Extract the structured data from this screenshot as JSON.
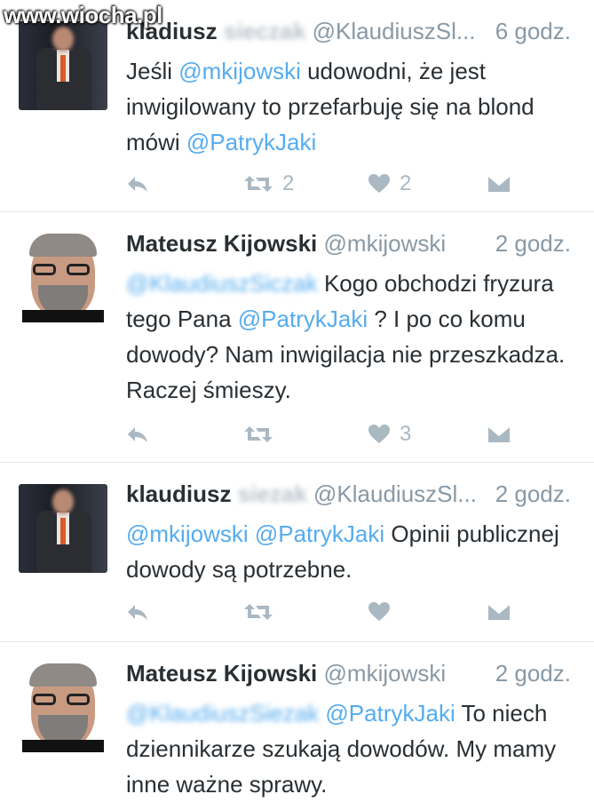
{
  "watermark": "www.wiocha.pl",
  "tweets": [
    {
      "name": "kladiusz",
      "name_hidden": "sieczak",
      "handle": "@KlaudiuszSl...",
      "time": "6 godz.",
      "text": [
        {
          "t": "Jeśli "
        },
        {
          "t": "@mkijowski",
          "cls": "mention"
        },
        {
          "t": " udowodni, że jest inwigilowany to przefarbuję się na blond mówi "
        },
        {
          "t": "@PatrykJaki",
          "cls": "mention"
        }
      ],
      "retweets": "2",
      "likes": "2"
    },
    {
      "name": "Mateusz Kijowski",
      "handle": "@mkijowski",
      "time": "2 godz.",
      "text": [
        {
          "t": "@KlaudiuszSiczak",
          "cls": "mention-blur"
        },
        {
          "t": " Kogo obchodzi fryzura tego Pana "
        },
        {
          "t": "@PatrykJaki",
          "cls": "mention"
        },
        {
          "t": " ? I po co komu dowody? Nam inwigilacja nie przeszkadza. Raczej śmieszy."
        }
      ],
      "retweets": "",
      "likes": "3"
    },
    {
      "name": "klaudiusz",
      "name_hidden": "siezak",
      "handle": "@KlaudiuszSl...",
      "time": "2 godz.",
      "text": [
        {
          "t": "@mkijowski",
          "cls": "mention"
        },
        {
          "t": " "
        },
        {
          "t": "@PatrykJaki",
          "cls": "mention"
        },
        {
          "t": " Opinii publicznej dowody są potrzebne."
        }
      ],
      "retweets": "",
      "likes": ""
    },
    {
      "name": "Mateusz Kijowski",
      "handle": "@mkijowski",
      "time": "2 godz.",
      "text": [
        {
          "t": "@KlaudiuszSiezak",
          "cls": "mention-blur"
        },
        {
          "t": " "
        },
        {
          "t": "@PatrykJaki",
          "cls": "mention"
        },
        {
          "t": " To niech dziennikarze szukają dowodów. My mamy inne ważne sprawy."
        }
      ]
    }
  ],
  "icons": {
    "reply": "reply-icon",
    "retweet": "retweet-icon",
    "like": "heart-icon",
    "message": "direct-message-icon"
  },
  "colors": {
    "mention": "#55acee",
    "muted": "#8899a6",
    "icon": "#aab8c2",
    "text": "#292f33"
  }
}
